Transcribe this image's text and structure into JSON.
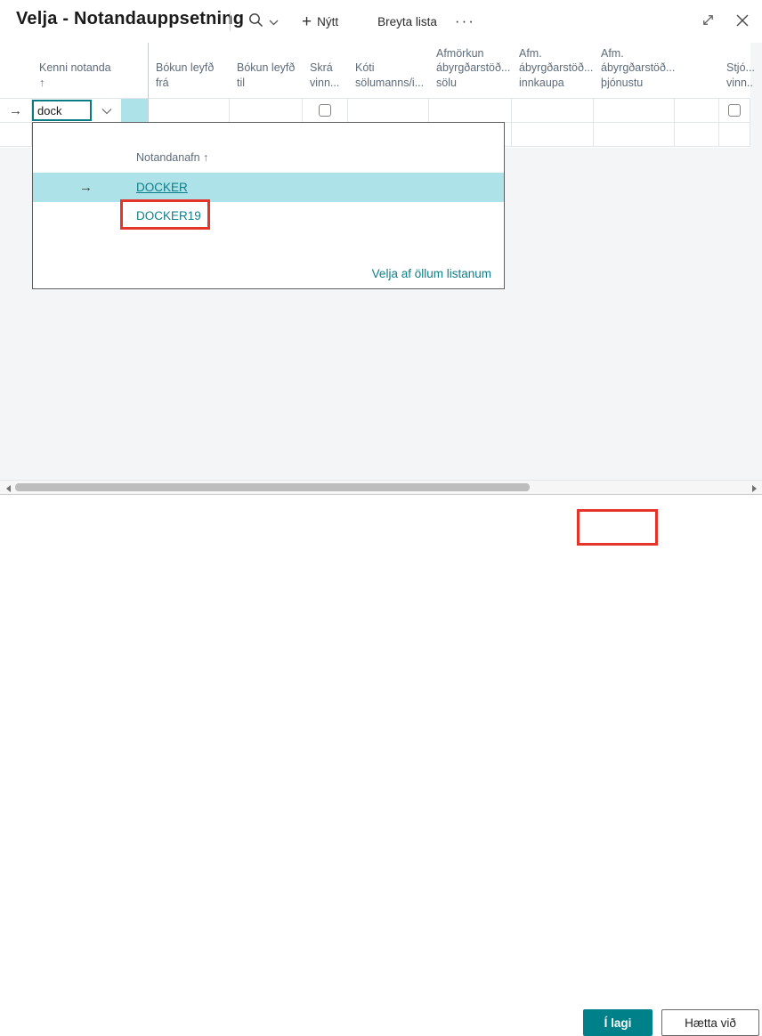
{
  "colors": {
    "accent": "#008089",
    "selection_highlight": "#ade2e8",
    "link_teal": "#0e7e88",
    "annotation_red": "#e5352b"
  },
  "window": {
    "title": "Velja - Notandauppsetning",
    "actions": {
      "new": "Nýtt",
      "edit_list": "Breyta lista",
      "more": "···"
    }
  },
  "icons": {
    "plus": "+",
    "row_marker": "→"
  },
  "grid": {
    "columns": [
      {
        "label": ""
      },
      {
        "label": "Kenni notanda\n↑"
      },
      {
        "label": "Bókun leyfð\nfrá"
      },
      {
        "label": "Bókun leyfð\ntil"
      },
      {
        "label": "Skrá\nvinn..."
      },
      {
        "label": "Kóti\nsölumanns/i..."
      },
      {
        "label": "Afmörkun\nábyrgðarstöð...\nsölu"
      },
      {
        "label": "Afm.\nábyrgðarstöð...\ninnkaupa"
      },
      {
        "label": "Afm.\nábyrgðarstöð...\nþjónustu"
      },
      {
        "label": ""
      },
      {
        "label": "Stjó...\nvinn.."
      }
    ],
    "edit_row": {
      "kenni_value": "dock"
    }
  },
  "dropdown": {
    "column_header": "Notandanafn ↑",
    "options": [
      {
        "label": "DOCKER"
      },
      {
        "label": "DOCKER19"
      }
    ],
    "footer_link": "Velja af öllum listanum"
  },
  "footer": {
    "ok_label": "Í lagi",
    "cancel_label": "Hætta við"
  }
}
